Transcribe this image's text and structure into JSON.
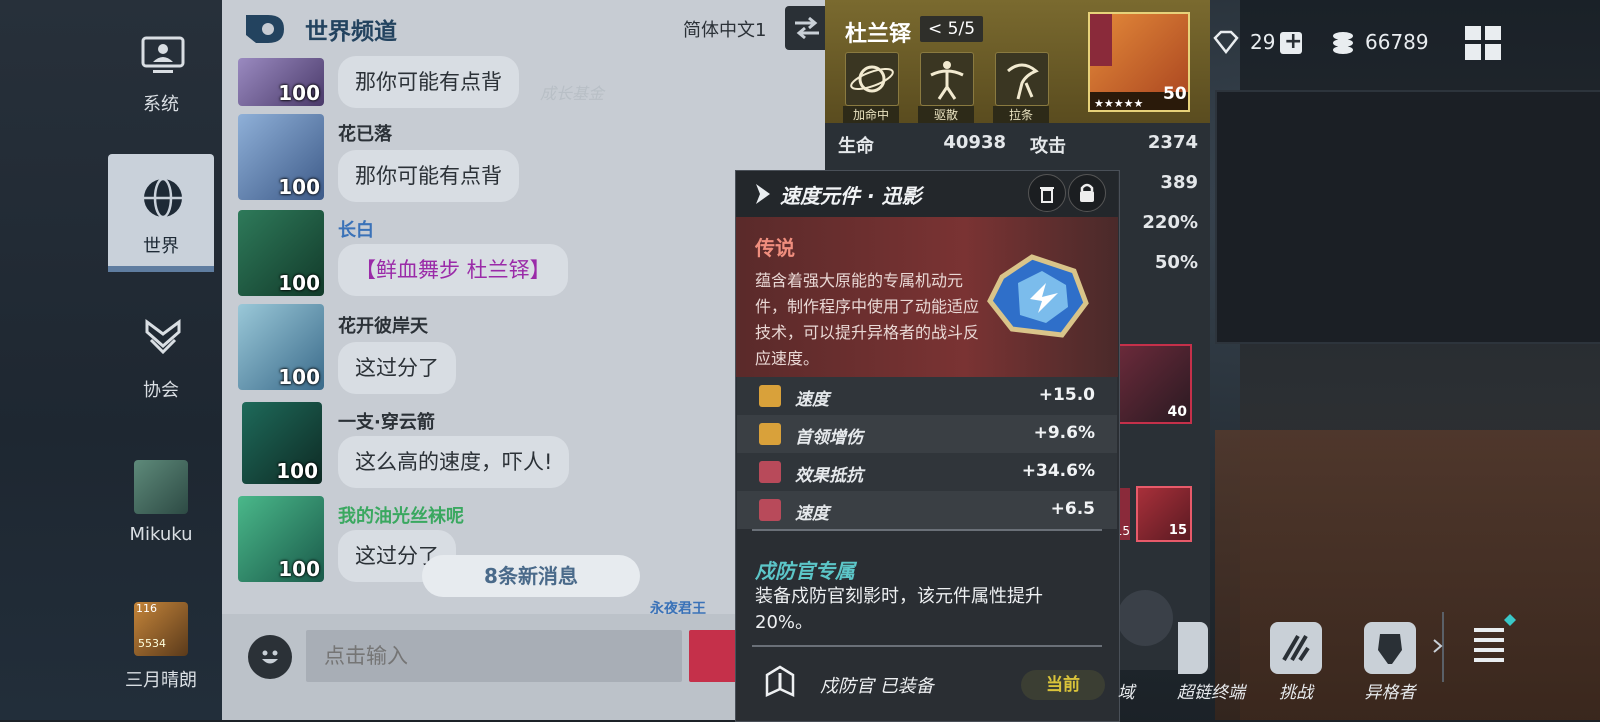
{
  "nav": {
    "items": [
      {
        "label": "系统",
        "icon": "monitor-icon"
      },
      {
        "label": "世界",
        "icon": "globe-icon"
      },
      {
        "label": "协会",
        "icon": "guild-icon"
      },
      {
        "label": "Mikuku",
        "icon": "avatar"
      },
      {
        "label": "三月晴朗",
        "icon": "avatar"
      }
    ],
    "badge_small": "116",
    "badge_code": "5534"
  },
  "chat": {
    "title": "世界频道",
    "language": "简体中文1",
    "messages": [
      {
        "user": "",
        "level": "100",
        "text": "那你可能有点背"
      },
      {
        "user": "花已落",
        "level": "100",
        "text": "那你可能有点背"
      },
      {
        "user": "长白",
        "level": "100",
        "text": "【鲜血舞步 杜兰铎】"
      },
      {
        "user": "花开彼岸天",
        "level": "100",
        "text": "这过分了"
      },
      {
        "user": "一支·穿云箭",
        "level": "100",
        "text": "这么高的速度，吓人!"
      },
      {
        "user": "我的油光丝袜呢",
        "level": "100",
        "text": "这过分了"
      }
    ],
    "new_messages": "8条新消息",
    "input_placeholder": "点击输入",
    "bg_text": "成长基金",
    "bottom_partial": "永夜君王"
  },
  "character": {
    "name": "杜兰铎",
    "share": "5/5",
    "level": "50",
    "skills": [
      "加命中",
      "驱散",
      "拉条"
    ],
    "stats": [
      {
        "label": "生命",
        "value": "40938"
      },
      {
        "label": "攻击",
        "value": "2374"
      }
    ],
    "stat_values": [
      "389",
      "220%",
      "50%"
    ],
    "item_level": "40",
    "item_levels": [
      "15",
      "15"
    ]
  },
  "currency": {
    "gems": "29",
    "coins": "66789"
  },
  "tooltip": {
    "title": "速度元件 · 迅影",
    "rarity": "传说",
    "description": "蕴含着强大原能的专属机动元件，制作程序中使用了动能适应技术，可以提升异格者的战斗反应速度。",
    "stats": [
      {
        "name": "速度",
        "value": "+15.0",
        "icon": "speed-icon",
        "color": "#d9a13a"
      },
      {
        "name": "首领增伤",
        "value": "+9.6%",
        "icon": "boss-damage-icon",
        "color": "#d9a13a"
      },
      {
        "name": "效果抵抗",
        "value": "+34.6%",
        "icon": "effect-resist-icon",
        "color": "#b84a5a"
      },
      {
        "name": "速度",
        "value": "+6.5",
        "icon": "speed-icon",
        "color": "#b84a5a"
      }
    ],
    "set_title": "戍防官专属",
    "set_desc": "装备戍防官刻影时，该元件属性提升20%。",
    "equipped": "戍防官 已装备",
    "current": "当前"
  },
  "bottom_menu": [
    {
      "label": "域"
    },
    {
      "label": "超链终端"
    },
    {
      "label": "挑战"
    },
    {
      "label": "异格者"
    }
  ],
  "colors": {
    "accent_red": "#c5304a",
    "legend_text": "#f08e7e",
    "set_title": "#5cc6c8",
    "gold": "#d9c33a"
  }
}
